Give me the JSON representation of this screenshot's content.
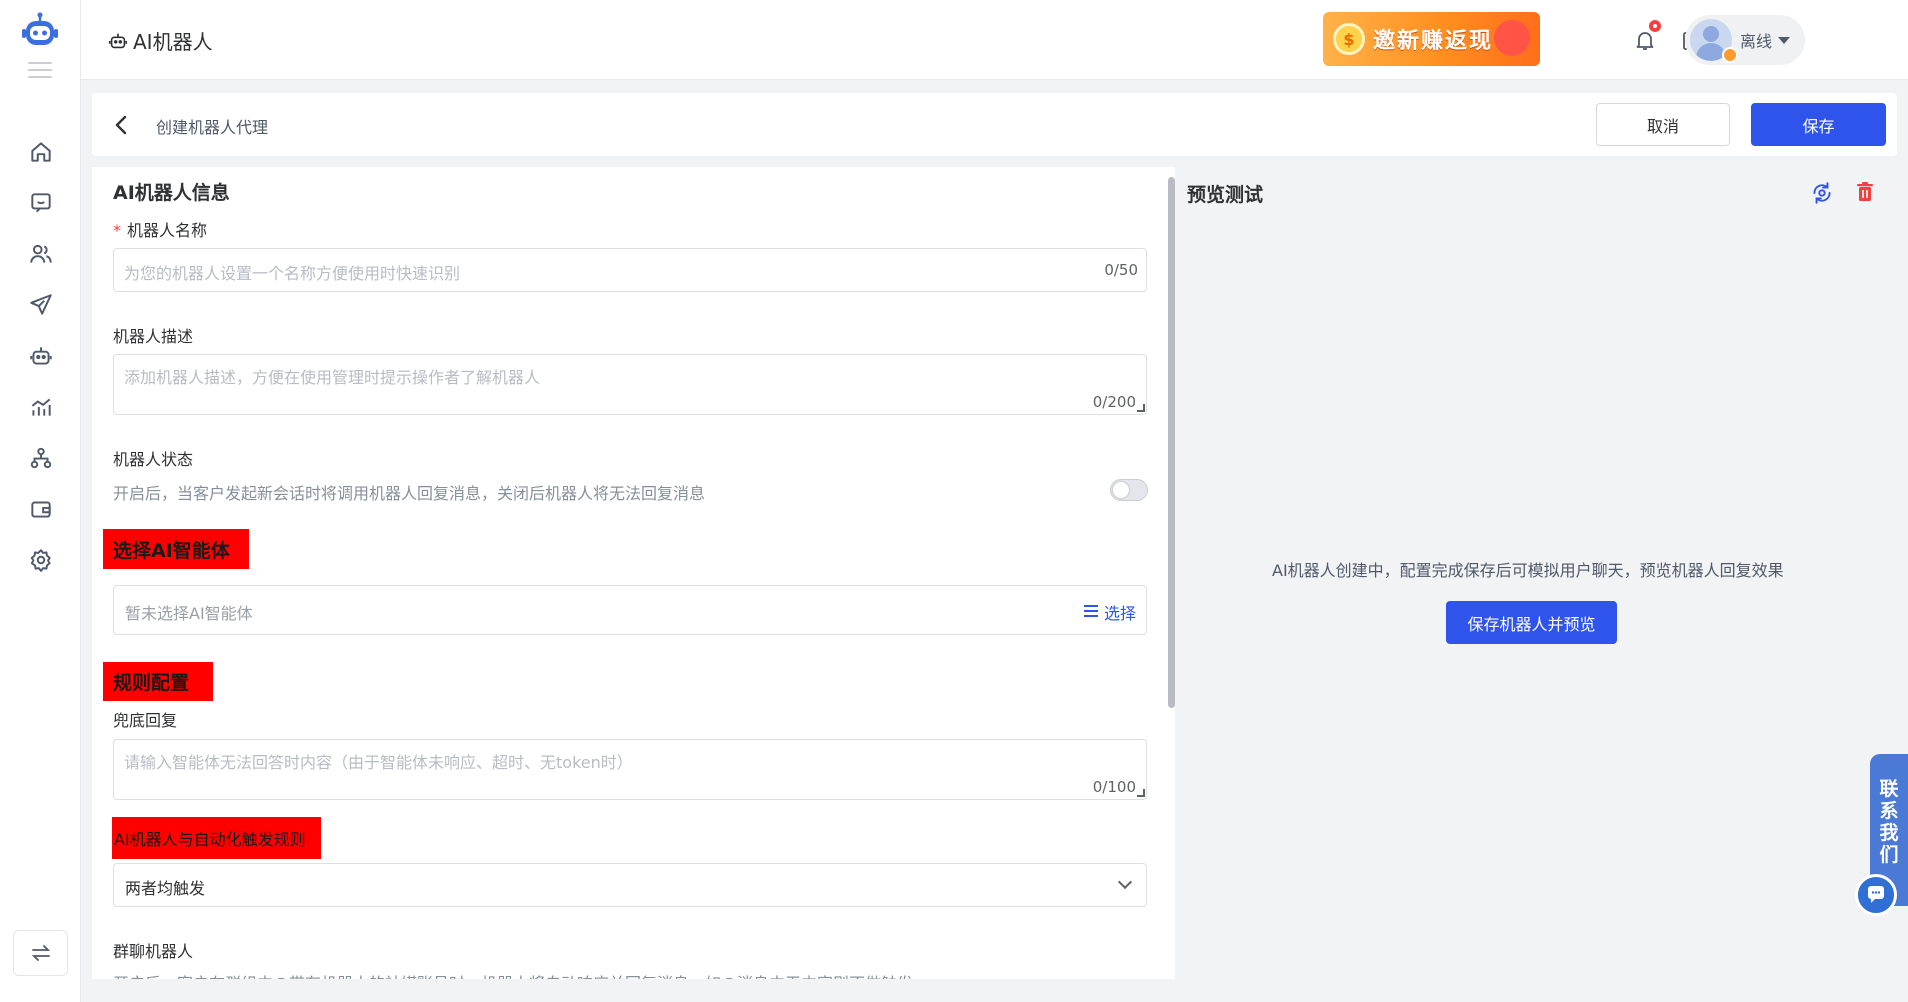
{
  "app": {
    "title": "AI机器人"
  },
  "header": {
    "promo_text": "邀新赚返现",
    "promo_coin": "$",
    "user_status": "离线"
  },
  "page": {
    "breadcrumb": "创建机器人代理",
    "cancel_label": "取消",
    "save_label": "保存"
  },
  "form": {
    "section_title": "AI机器人信息",
    "name": {
      "label": "机器人名称",
      "required_mark": "*",
      "placeholder": "为您的机器人设置一个名称方便使用时快速识别",
      "count": "0/50"
    },
    "description": {
      "label": "机器人描述",
      "placeholder": "添加机器人描述，方便在使用管理时提示操作者了解机器人",
      "count": "0/200"
    },
    "status": {
      "label": "机器人状态",
      "help": "开启后，当客户发起新会话时将调用机器人回复消息，关闭后机器人将无法回复消息",
      "enabled": false
    },
    "agent": {
      "section_label": "选择AI智能体",
      "placeholder": "暂未选择AI智能体",
      "pick_label": "选择"
    },
    "rules": {
      "section_label": "规则配置"
    },
    "fallback": {
      "label": "兜底回复",
      "placeholder": "请输入智能体无法回答时内容（由于智能体未响应、超时、无token时）",
      "count": "0/100"
    },
    "trigger": {
      "section_label": "AI机器人与自动化触发规则",
      "selected": "两者均触发"
    },
    "group": {
      "label": "群聊机器人",
      "help": "开启后，客户在群组中@带有机器人的社媒账号时，机器人将自动响应并回复消息，如@消息中无内容则不做触发"
    }
  },
  "preview": {
    "title": "预览测试",
    "message": "AI机器人创建中，配置完成保存后可模拟用户聊天，预览机器人回复效果",
    "button_label": "保存机器人并预览"
  },
  "contact": {
    "label": "联系我们"
  },
  "colors": {
    "primary": "#2f54eb",
    "danger": "#f53f3f",
    "highlight": "#ff0000"
  }
}
